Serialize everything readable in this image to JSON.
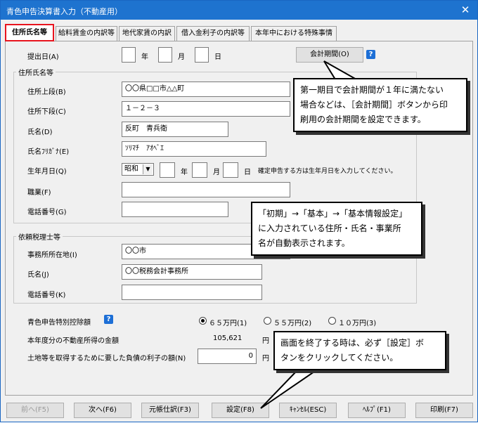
{
  "window": {
    "title": "青色申告決算書入力（不動産用）",
    "close": "✕"
  },
  "tabs": [
    {
      "label": "住所氏名等"
    },
    {
      "label": "給料賃金の内訳等"
    },
    {
      "label": "地代家賃の内訳"
    },
    {
      "label": "借入金利子の内訳等"
    },
    {
      "label": "本年中における特殊事情"
    }
  ],
  "submit_date": {
    "label": "提出日(A)",
    "year": "年",
    "month": "月",
    "day": "日"
  },
  "period_button": "会計期間(O)",
  "address_group": {
    "title": "住所氏名等",
    "addr1_label": "住所上段(B)",
    "addr1": "〇〇県□□市△△町",
    "addr2_label": "住所下段(C)",
    "addr2": "１－２－３",
    "name_label": "氏名(D)",
    "name": "反町　青兵衛",
    "kana_label": "氏名ﾌﾘｶﾞﾅ(E)",
    "kana": "ｿﾘﾏﾁ　ｱｵﾍﾞｴ",
    "birth_label": "生年月日(Q)",
    "era": "昭和",
    "birth_year": "年",
    "birth_month": "月",
    "birth_day": "日",
    "birth_note": "確定申告する方は生年月日を入力してください。",
    "job_label": "職業(F)",
    "tel_label": "電話番号(G)"
  },
  "agent_group": {
    "title": "依頼税理士等",
    "office_label": "事務所所在地(I)",
    "office": "〇〇市",
    "name_label": "氏名(J)",
    "name": "〇〇税務会計事務所",
    "tel_label": "電話番号(K)"
  },
  "deduction": {
    "label": "青色申告特別控除額",
    "options": [
      "６５万円(1)",
      "５５万円(2)",
      "１０万円(3)"
    ],
    "selected": 0
  },
  "income": {
    "label": "本年度分の不動産所得の金額",
    "value": "105,621",
    "unit": "円"
  },
  "interest": {
    "label": "土地等を取得するために要した負債の利子の額(N)",
    "value": "0",
    "unit": "円"
  },
  "help_mark": "?",
  "footer": {
    "prev": "前へ(F5)",
    "next": "次へ(F6)",
    "ledger": "元帳仕訳(F3)",
    "settings": "設定(F8)",
    "cancel": "ｷｬﾝｾﾙ(ESC)",
    "help": "ﾍﾙﾌﾟ(F1)",
    "print": "印刷(F7)"
  },
  "callouts": {
    "period": [
      "第一期目で会計期間が１年に満たない",
      "場合などは、［会計期間］ボタンから印",
      "刷用の会計期間を設定できます。"
    ],
    "auto": [
      "「初期」→「基本」→「基本情報設定」",
      "に入力されている住所・氏名・事業所",
      "名が自動表示されます。"
    ],
    "close": [
      "画面を終了する時は、必ず［設定］ボ",
      "タンをクリックしてください。"
    ]
  }
}
